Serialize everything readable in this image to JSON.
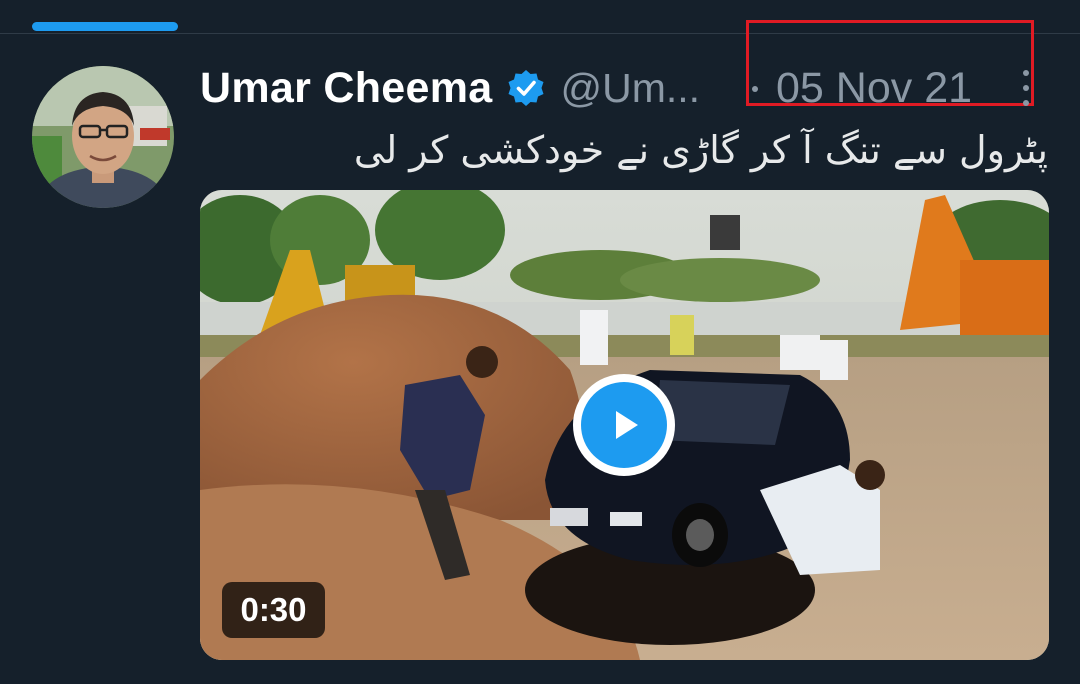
{
  "tweet": {
    "display_name": "Umar Cheema",
    "handle": "@Um...",
    "timestamp": "05 Nov 21",
    "text": "پٹرول سے تنگ آ کر گاڑی نے خودکشی کر لی"
  },
  "media": {
    "duration": "0:30"
  },
  "icons": {
    "verified": "verified-badge-icon",
    "more": "more-options-icon",
    "play": "play-icon"
  },
  "colors": {
    "background": "#15202b",
    "accent": "#1d9bf0",
    "secondary_text": "#8b98a5",
    "highlight": "#e01b24"
  }
}
